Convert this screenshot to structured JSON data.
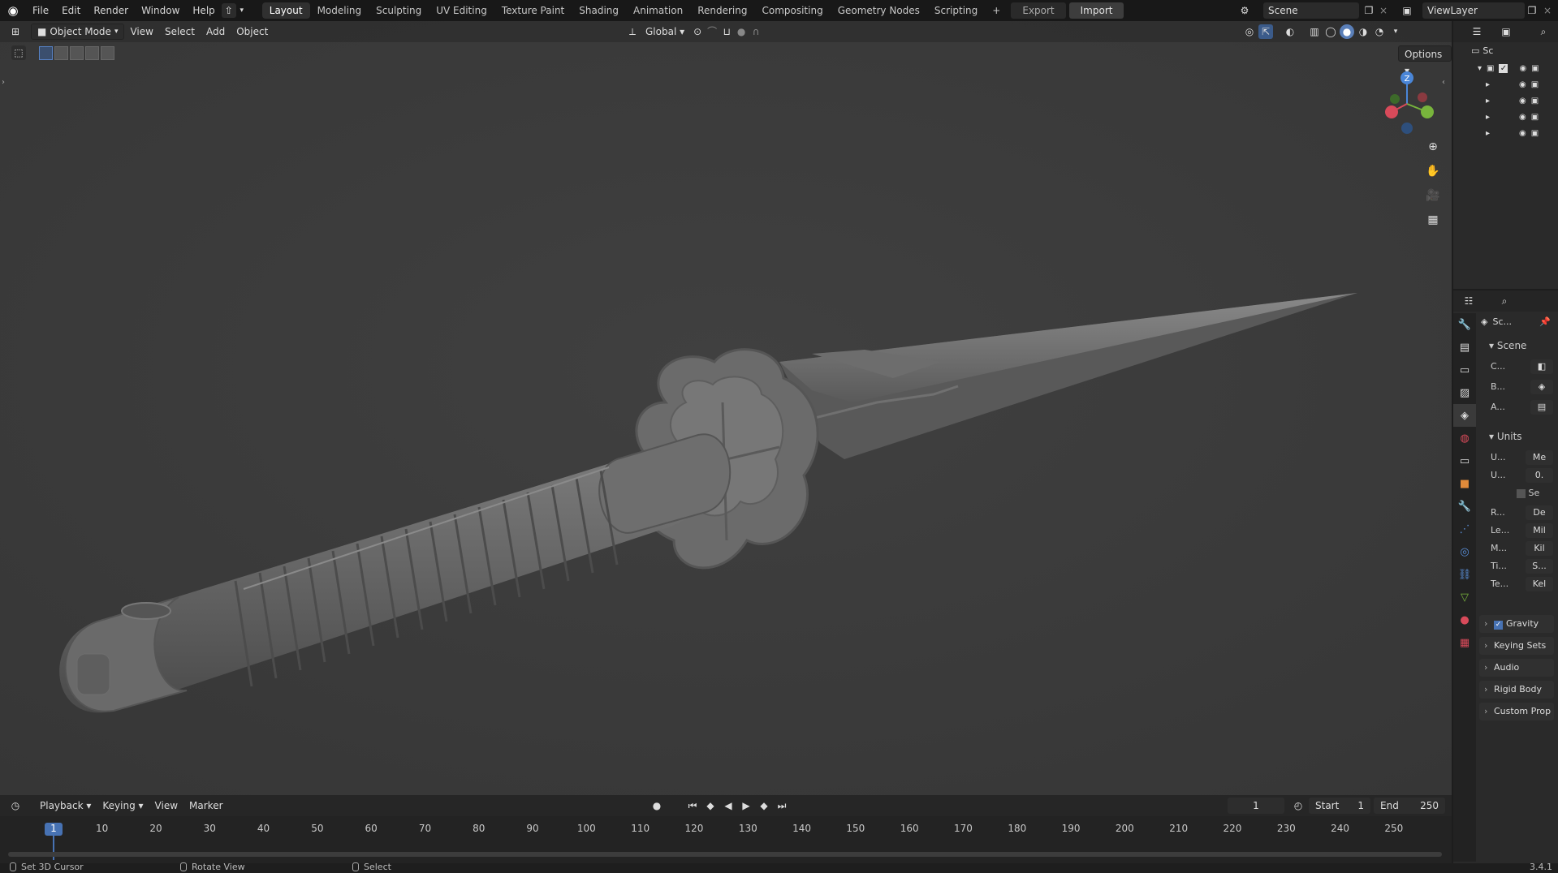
{
  "topbar": {
    "menus": [
      "File",
      "Edit",
      "Render",
      "Window",
      "Help"
    ],
    "workspaces": [
      "Layout",
      "Modeling",
      "Sculpting",
      "UV Editing",
      "Texture Paint",
      "Shading",
      "Animation",
      "Rendering",
      "Compositing",
      "Geometry Nodes",
      "Scripting"
    ],
    "active_workspace": "Layout",
    "add_workspace": "+",
    "export_label": "Export",
    "import_label": "Import",
    "scene_name": "Scene",
    "view_layer": "ViewLayer"
  },
  "viewport_header": {
    "mode": "Object Mode",
    "menus": [
      "View",
      "Select",
      "Add",
      "Object"
    ],
    "orientation": "Global",
    "options_label": "Options"
  },
  "gizmo": {
    "z": "Z",
    "y": "Y",
    "x": "X"
  },
  "timeline": {
    "menus": [
      "Playback",
      "Keying",
      "View",
      "Marker"
    ],
    "current_frame": "1",
    "start_label": "Start",
    "start_value": "1",
    "end_label": "End",
    "end_value": "250",
    "ticks": [
      "1",
      "10",
      "20",
      "30",
      "40",
      "50",
      "60",
      "70",
      "80",
      "90",
      "100",
      "110",
      "120",
      "130",
      "140",
      "150",
      "160",
      "170",
      "180",
      "190",
      "200",
      "210",
      "220",
      "230",
      "240",
      "250"
    ]
  },
  "status": {
    "left": "Set 3D Cursor",
    "middle": "Rotate View",
    "right": "Select",
    "version": "3.4.1"
  },
  "outliner": {
    "scene_label": "Sc"
  },
  "properties": {
    "tab_title": "Sc...",
    "scene_panel": "Scene",
    "camera_label": "C...",
    "background_label": "B...",
    "active_clip_label": "A...",
    "units_panel": "Units",
    "unit_system_label": "U...",
    "unit_system_value": "Me",
    "unit_scale_label": "U...",
    "unit_scale_value": "0.",
    "separate_units": "Se",
    "rotation_label": "R...",
    "rotation_value": "De",
    "length_label": "Le...",
    "length_value": "Mil",
    "mass_label": "M...",
    "mass_value": "Kil",
    "time_label": "Ti...",
    "time_value": "S...",
    "temp_label": "Te...",
    "temp_value": "Kel",
    "gravity": "Gravity",
    "keying_sets": "Keying Sets",
    "audio": "Audio",
    "rigid_body": "Rigid Body",
    "custom_props": "Custom Prop"
  }
}
